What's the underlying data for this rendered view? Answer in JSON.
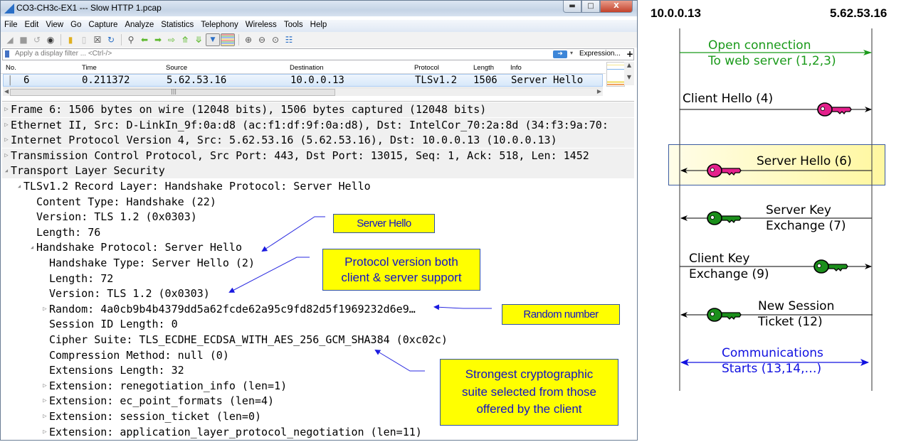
{
  "window": {
    "title": "CO3-CH3c-EX1 --- Slow HTTP 1.pcap",
    "controls": [
      "minimize",
      "maximize",
      "close"
    ]
  },
  "menu": [
    "File",
    "Edit",
    "View",
    "Go",
    "Capture",
    "Analyze",
    "Statistics",
    "Telephony",
    "Wireless",
    "Tools",
    "Help"
  ],
  "toolbar_icons": [
    "shark-fin-start-icon",
    "stop-icon",
    "restart-icon",
    "capture-options-icon",
    "open-file-icon",
    "save-icon",
    "close-file-icon",
    "reload-icon",
    "find-icon",
    "back-arrow-icon",
    "forward-arrow-icon",
    "go-to-packet-icon",
    "first-packet-icon",
    "last-packet-icon",
    "autoscroll-icon",
    "colorize-icon",
    "zoom-in-icon",
    "zoom-out-icon",
    "normal-size-icon",
    "resize-columns-icon"
  ],
  "filter": {
    "placeholder": "Apply a display filter ... <Ctrl-/>",
    "expression_label": "Expression...",
    "add_label": "+"
  },
  "packet_list": {
    "columns": [
      "No.",
      "Time",
      "Source",
      "Destination",
      "Protocol",
      "Length",
      "Info"
    ],
    "rows": [
      {
        "no": "6",
        "time": "0.211372",
        "source": "5.62.53.16",
        "destination": "10.0.0.13",
        "protocol": "TLSv1.2",
        "length": "1506",
        "info": "Server Hello"
      }
    ]
  },
  "details": [
    {
      "text": "Frame 6: 1506 bytes on wire (12048 bits), 1506 bytes captured (12048 bits)",
      "toggle": "collapsed",
      "indent": 0
    },
    {
      "text": "Ethernet II, Src: D-LinkIn_9f:0a:d8 (ac:f1:df:9f:0a:d8), Dst: IntelCor_70:2a:8d (34:f3:9a:70:",
      "toggle": "collapsed",
      "indent": 0
    },
    {
      "text": "Internet Protocol Version 4, Src: 5.62.53.16 (5.62.53.16), Dst: 10.0.0.13 (10.0.0.13)",
      "toggle": "collapsed",
      "indent": 0
    },
    {
      "text": "Transmission Control Protocol, Src Port: 443, Dst Port: 13015, Seq: 1, Ack: 518, Len: 1452",
      "toggle": "collapsed",
      "indent": 0
    },
    {
      "text": "Transport Layer Security",
      "toggle": "expanded",
      "indent": 0
    },
    {
      "text": "TLSv1.2 Record Layer: Handshake Protocol: Server Hello",
      "toggle": "expanded",
      "indent": 1
    },
    {
      "text": "Content Type: Handshake (22)",
      "toggle": "none",
      "indent": 2
    },
    {
      "text": "Version: TLS 1.2 (0x0303)",
      "toggle": "none",
      "indent": 2
    },
    {
      "text": "Length: 76",
      "toggle": "none",
      "indent": 2
    },
    {
      "text": "Handshake Protocol: Server Hello",
      "toggle": "expanded",
      "indent": 2
    },
    {
      "text": "Handshake Type: Server Hello (2)",
      "toggle": "none",
      "indent": 3
    },
    {
      "text": "Length: 72",
      "toggle": "none",
      "indent": 3
    },
    {
      "text": "Version: TLS 1.2 (0x0303)",
      "toggle": "none",
      "indent": 3
    },
    {
      "text": "Random: 4a0cb9b4b4379dd5a62fcde62a95c9fd82d5f1969232d6e9…",
      "toggle": "collapsed",
      "indent": 3
    },
    {
      "text": "Session ID Length: 0",
      "toggle": "none",
      "indent": 3
    },
    {
      "text": "Cipher Suite: TLS_ECDHE_ECDSA_WITH_AES_256_GCM_SHA384 (0xc02c)",
      "toggle": "none",
      "indent": 3
    },
    {
      "text": "Compression Method: null (0)",
      "toggle": "none",
      "indent": 3
    },
    {
      "text": "Extensions Length: 32",
      "toggle": "none",
      "indent": 3
    },
    {
      "text": "Extension: renegotiation_info (len=1)",
      "toggle": "collapsed",
      "indent": 3
    },
    {
      "text": "Extension: ec_point_formats (len=4)",
      "toggle": "collapsed",
      "indent": 3
    },
    {
      "text": "Extension: session_ticket (len=0)",
      "toggle": "collapsed",
      "indent": 3
    },
    {
      "text": "Extension: application_layer_protocol_negotiation (len=11)",
      "toggle": "collapsed",
      "indent": 3
    }
  ],
  "callouts": {
    "server_hello": "Server Hello",
    "protocol_version": [
      "Protocol version both",
      "client & server support"
    ],
    "random_number": "Random number",
    "cipher_suite": [
      "Strongest cryptographic",
      "suite selected from those",
      "offered by the client"
    ]
  },
  "sequence": {
    "client": "10.0.0.13",
    "server": "5.62.53.16",
    "colors": {
      "connect": "#1a9a1a",
      "handshake": "#000000",
      "comm": "#1010e0",
      "key_pink": "#e4208c",
      "key_green": "#1b8f1b",
      "highlight": "#fff7a0"
    },
    "messages": [
      {
        "lines": [
          "Open connection",
          "To web server (1,2,3)"
        ],
        "direction": "to-server",
        "color": "connect",
        "key": "none"
      },
      {
        "lines": [
          "Client Hello (4)"
        ],
        "direction": "to-server",
        "color": "handshake",
        "key": "pink"
      },
      {
        "lines": [
          "Server Hello (6)"
        ],
        "direction": "to-client",
        "color": "handshake",
        "key": "pink",
        "highlighted": true
      },
      {
        "lines": [
          "Server Key",
          "Exchange (7)"
        ],
        "direction": "to-client",
        "color": "handshake",
        "key": "green"
      },
      {
        "lines": [
          "Client Key",
          "Exchange (9)"
        ],
        "direction": "to-server",
        "color": "handshake",
        "key": "green"
      },
      {
        "lines": [
          "New Session",
          "Ticket (12)"
        ],
        "direction": "to-client",
        "color": "handshake",
        "key": "green"
      },
      {
        "lines": [
          "Communications",
          "Starts (13,14,…)"
        ],
        "direction": "both",
        "color": "comm",
        "key": "none"
      }
    ]
  }
}
